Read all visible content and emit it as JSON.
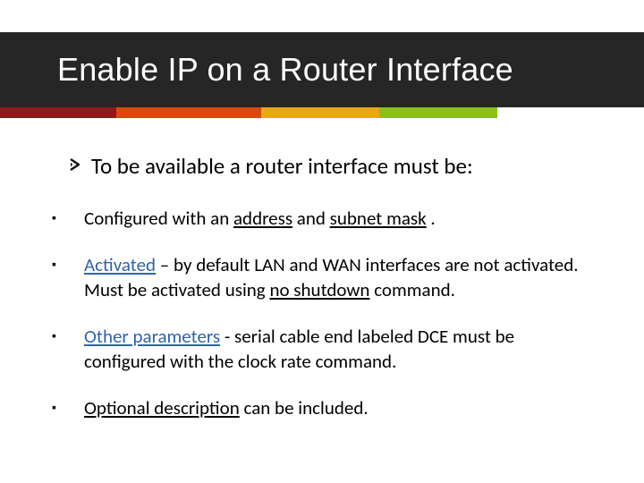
{
  "title": "Enable IP on a Router Interface",
  "main": {
    "text": "To be available a router interface  must be:"
  },
  "subs": [
    {
      "pre": "Configured with an ",
      "u1": "address",
      "mid": " and ",
      "u2": "subnet mask",
      "post": " ."
    },
    {
      "blue_u": "Activated",
      "dash": " – ",
      "body1": "by default LAN and WAN interfaces are not activated. Must be activated using ",
      "u1": "no shutdown",
      "post": " command."
    },
    {
      "blue_u": "Other parameters",
      "sep": " -  ",
      "body1": "serial cable end labeled DCE must be configured with the clock rate command."
    },
    {
      "u1": "Optional description",
      "post": " can be included."
    }
  ]
}
